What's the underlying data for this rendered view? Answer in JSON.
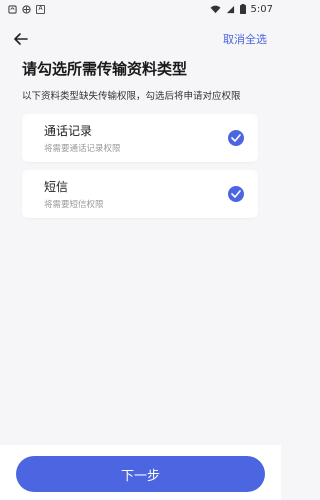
{
  "status_bar": {
    "time": "5:07",
    "left_icons": [
      "notification-icon",
      "app-icon",
      "a-icon"
    ],
    "right_icons": [
      "wifi-icon",
      "signal-icon",
      "battery-icon"
    ]
  },
  "header": {
    "cancel_all_label": "取消全选",
    "title": "请勾选所需传输资料类型",
    "subtitle": "以下资料类型缺失传输权限，勾选后将申请对应权限"
  },
  "items": [
    {
      "label": "通话记录",
      "desc": "将需要通话记录权限",
      "checked": true
    },
    {
      "label": "短信",
      "desc": "将需要短信权限",
      "checked": true
    }
  ],
  "footer": {
    "next_label": "下一步"
  },
  "colors": {
    "accent": "#4b66e0",
    "background": "#f6f6f8"
  }
}
